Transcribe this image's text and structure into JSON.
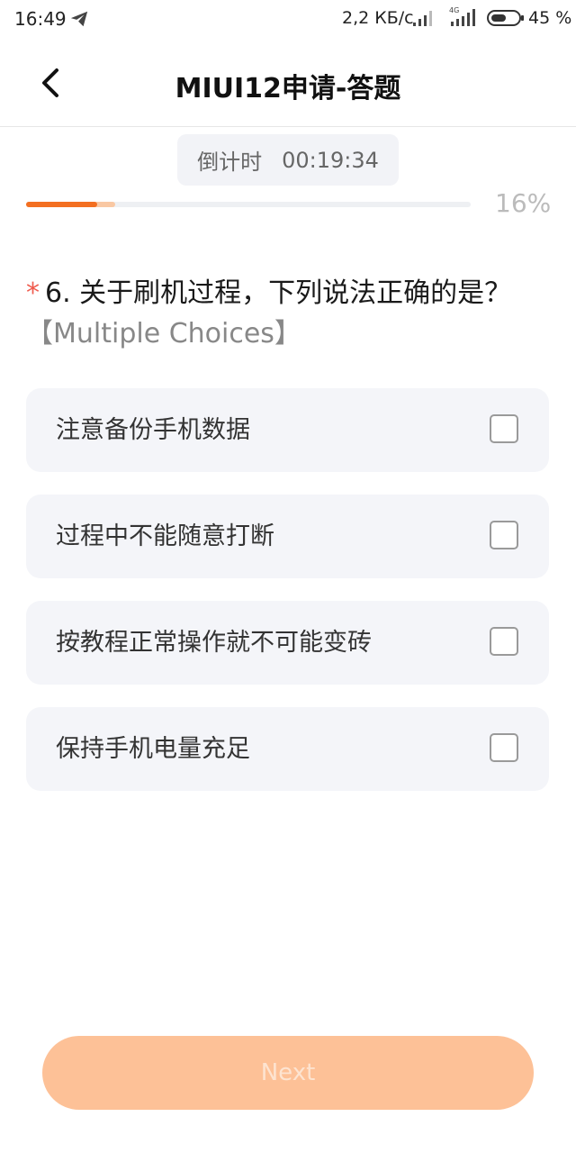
{
  "status_bar": {
    "time": "16:49",
    "network_speed": "2,2 КБ/с",
    "network_type": "4G",
    "battery": "45 %",
    "icons": [
      "telegram-send-icon",
      "signal-icon",
      "signal-4g-icon",
      "battery-icon"
    ]
  },
  "header": {
    "back_icon": "chevron-left-icon",
    "title": "MIUI12申请-答题"
  },
  "timer": {
    "label": "倒计时",
    "value": "00:19:34"
  },
  "progress": {
    "percent_value": 16,
    "label": "16%",
    "accent_color": "#f36f21"
  },
  "question": {
    "required_marker": "*",
    "text": "6. 关于刷机过程，下列说法正确的是？",
    "type": "【Multiple Choices】"
  },
  "options": [
    {
      "label": "注意备份手机数据",
      "checked": false
    },
    {
      "label": "过程中不能随意打断",
      "checked": false
    },
    {
      "label": "按教程正常操作就不可能变砖",
      "checked": false
    },
    {
      "label": "保持手机电量充足",
      "checked": false
    }
  ],
  "next_button": {
    "label": "Next",
    "enabled": false,
    "color": "#fdc197"
  }
}
